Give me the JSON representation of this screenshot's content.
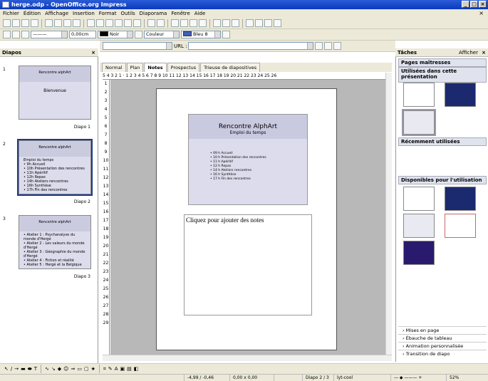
{
  "window": {
    "title": "herge.odp - OpenOffice.org Impress"
  },
  "menu": [
    "Fichier",
    "Édition",
    "Affichage",
    "Insertion",
    "Format",
    "Outils",
    "Diaporama",
    "Fenêtre",
    "Aide"
  ],
  "toolbar2": {
    "line_width": "0,00cm",
    "line_color": "Noir",
    "area_style": "Couleur",
    "area_color": "Bleu 8",
    "url_label": "URL :",
    "swatch_line": "#000000",
    "swatch_area": "#4060c0"
  },
  "slides_pane": {
    "title": "Diapos",
    "slides": [
      {
        "num": "1",
        "label": "Diapo 1",
        "heading": "Rencontre alphArt",
        "body": [
          "Bienvenue"
        ]
      },
      {
        "num": "2",
        "label": "Diapo 2",
        "heading": "Rencontre alphArt",
        "sub": "Emploi du temps",
        "body": [
          "• 9h Accueil",
          "• 10h Présentation des rencontres",
          "• 11h Apéritif",
          "• 12h Repas",
          "• 14h Ateliers rencontres",
          "• 16h Synthèse",
          "• 17h Fin des rencontres"
        ]
      },
      {
        "num": "3",
        "label": "Diapo 3",
        "heading": "Rencontre alphArt",
        "body": [
          "• Atelier 1 : Psychanalyse du monde d'Hergé",
          "• Atelier 2 : Les valeurs du monde d'Hergé",
          "• Atelier 3 : Géographie du monde d'Hergé",
          "• Atelier 4 : Fiction et réalité",
          "• Atelier 5 : Hergé et la Belgique"
        ]
      }
    ]
  },
  "view_tabs": [
    "Normal",
    "Plan",
    "Notes",
    "Prospectus",
    "Trieuse de diapositives"
  ],
  "rulers": {
    "horizontal": "5 4 3 2 1 · 1 2 3 4 5 6 7 8 9 10 11 12 13 14 15 16 17 18 19 20 21 22 23 24 25 26",
    "vertical": [
      "1",
      "2",
      "3",
      "4",
      "5",
      "6",
      "7",
      "8",
      "9",
      "10",
      "11",
      "12",
      "13",
      "14",
      "15",
      "16",
      "17",
      "18",
      "19",
      "20",
      "21",
      "22",
      "23",
      "24",
      "25",
      "26",
      "27",
      "28",
      "29"
    ]
  },
  "notes_page": {
    "slide_title": "Rencontre AlphArt",
    "slide_subtitle": "Emploi du temps",
    "slide_items": [
      "09 h Accueil",
      "10 h Présentation des rencontres",
      "11 h Apéritif",
      "12 h Repas",
      "14 h Ateliers rencontres",
      "16 h Synthèse",
      "17 h Fin des rencontres"
    ],
    "notes_placeholder": "Cliquez pour ajouter des notes"
  },
  "tasks_pane": {
    "title": "Tâches",
    "view_menu": "Afficher",
    "master_pages": "Pages maîtresses",
    "used": "Utilisées dans cette présentation",
    "recent": "Récemment utilisées",
    "available": "Disponibles pour l'utilisation",
    "links": [
      "Mises en page",
      "Ébauche de tableau",
      "Animation personnalisée",
      "Transition de diapo"
    ]
  },
  "status": {
    "position": "-4,99 / -0,46",
    "size": "0,00 x 0,00",
    "slide": "Diapo 2 / 3",
    "master": "lyt-cool",
    "zoom": "52%"
  }
}
